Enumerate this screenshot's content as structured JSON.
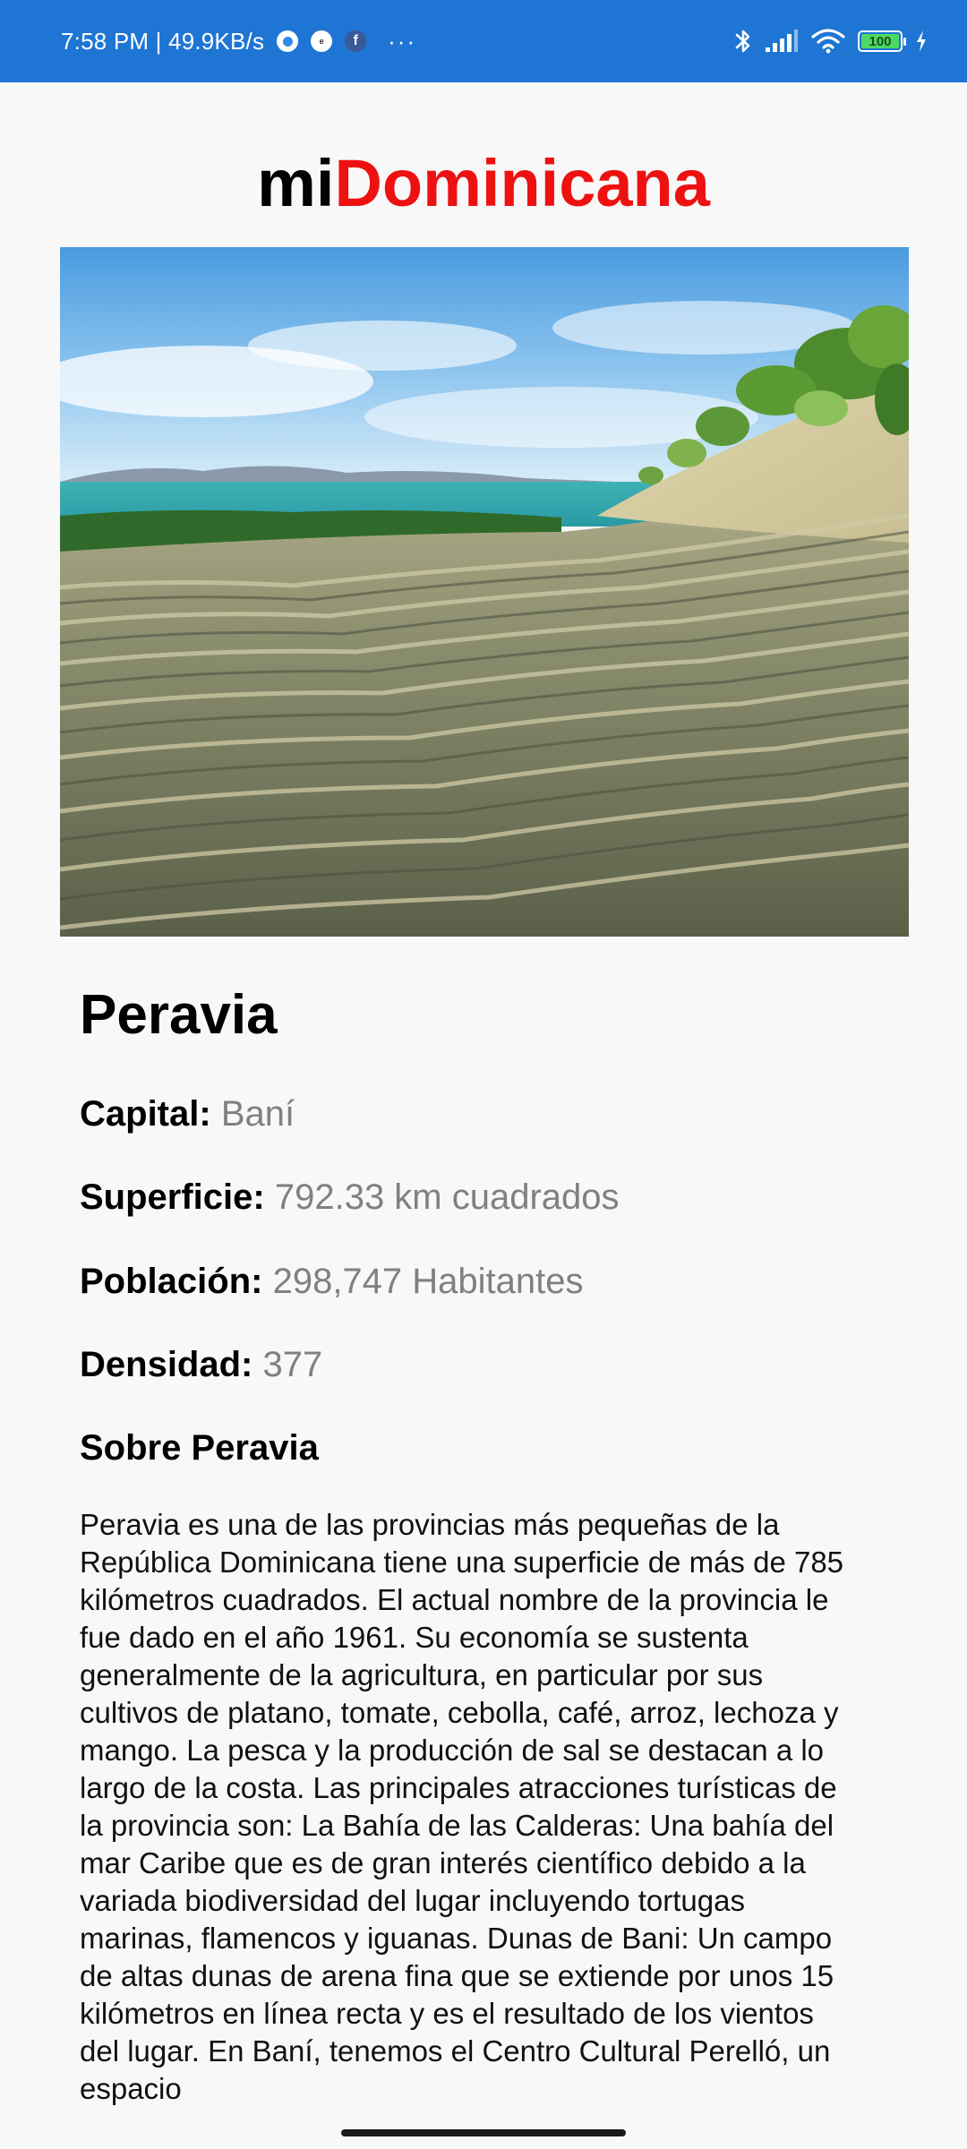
{
  "status_bar": {
    "time_speed": "7:58 PM | 49.9KB/s",
    "more": "···",
    "battery": "100",
    "battery_color": "#4cd964",
    "background": "#1e75d3"
  },
  "app": {
    "brand_prefix": "mi",
    "brand_suffix": "Dominicana",
    "brand_suffix_color": "#ee1111"
  },
  "province": {
    "name": "Peravia",
    "fields": {
      "capital_label": "Capital:",
      "capital_value": "Baní",
      "superficie_label": "Superficie:",
      "superficie_value": "792.33 km cuadrados",
      "poblacion_label": "Población:",
      "poblacion_value": "298,747 Habitantes",
      "densidad_label": "Densidad:",
      "densidad_value": "377"
    },
    "about_title": "Sobre Peravia",
    "about_text": "Peravia es una de las provincias más pequeñas de la República Dominicana tiene una superficie de más de 785 kilómetros cuadrados. El actual nombre de la provincia le fue dado en el año 1961. Su economía se sustenta generalmente de la agricultura, en particular por sus cultivos de platano, tomate, cebolla, café, arroz, lechoza y mango. La pesca y la producción de sal se destacan a lo largo de la costa. Las principales atracciones turísticas de la provincia son: La Bahía de las Calderas: Una bahía del mar Caribe que es de gran interés científico debido a la variada biodiversidad del lugar incluyendo tortugas marinas, flamencos y iguanas. Dunas de Bani: Un campo de altas dunas de arena fina que se extiende por unos 15 kilómetros en línea recta y es el resultado de los vientos del lugar. En Baní, tenemos el Centro Cultural Perelló, un espacio"
  }
}
